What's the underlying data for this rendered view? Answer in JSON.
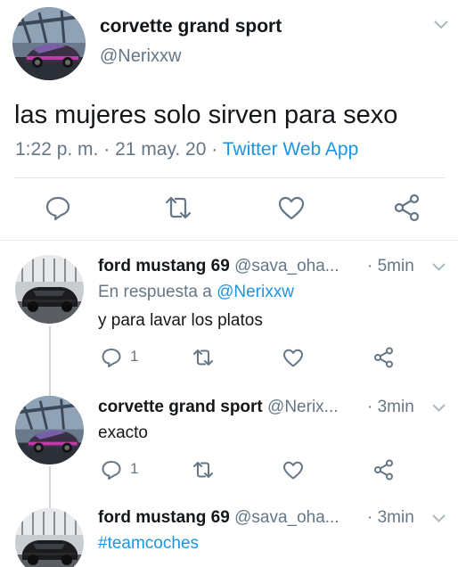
{
  "main_tweet": {
    "display_name": "corvette grand sport",
    "handle": "@Nerixxw",
    "text": "las mujeres solo sirven para sexo",
    "time": "1:22 p. m.",
    "date": "21 may. 20",
    "separator": "·",
    "source": "Twitter Web App",
    "avatar_icon": "car-avatar-corvette",
    "actions": [
      "reply-icon",
      "retweet-icon",
      "like-icon",
      "share-icon"
    ]
  },
  "replies": [
    {
      "display_name": "ford mustang 69",
      "handle": "@sava_oha...",
      "time": "· 5min",
      "replying_prefix": "En respuesta a",
      "replying_mention": "@Nerixxw",
      "text": "y para lavar los platos",
      "reply_count": "1",
      "avatar_icon": "car-avatar-mustang"
    },
    {
      "display_name": "corvette grand sport",
      "handle": "@Nerix...",
      "time": "· 3min",
      "text": "exacto",
      "reply_count": "1",
      "avatar_icon": "car-avatar-corvette"
    },
    {
      "display_name": "ford mustang 69",
      "handle": "@sava_oha...",
      "time": "· 3min",
      "hashtag": "#teamcoches",
      "avatar_icon": "car-avatar-mustang"
    }
  ],
  "colors": {
    "link": "#1b95e0",
    "secondary_text": "#657786",
    "primary_text": "#14171a",
    "icon": "#657786",
    "divider": "#e6ecf0"
  }
}
